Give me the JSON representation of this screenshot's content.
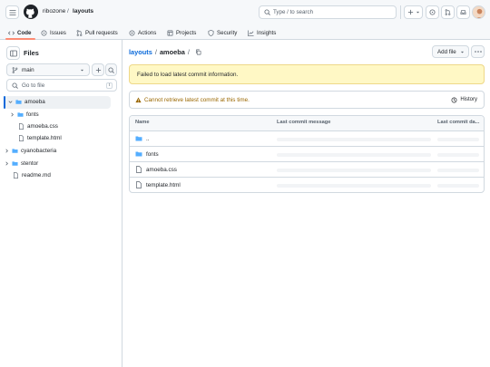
{
  "header": {
    "owner": "ribozone",
    "repo": "layouts",
    "search_placeholder": "Type / to search",
    "separator": "/"
  },
  "tabs": [
    {
      "label": "Code"
    },
    {
      "label": "Issues"
    },
    {
      "label": "Pull requests"
    },
    {
      "label": "Actions"
    },
    {
      "label": "Projects"
    },
    {
      "label": "Security"
    },
    {
      "label": "Insights"
    }
  ],
  "sidebar": {
    "title": "Files",
    "branch": "main",
    "filter_placeholder": "Go to file",
    "filter_shortcut": "t",
    "items": [
      {
        "label": "amoeba",
        "type": "folder",
        "expanded": true,
        "selected": true
      },
      {
        "label": "fonts",
        "type": "folder",
        "expanded": false
      },
      {
        "label": "amoeba.css",
        "type": "file"
      },
      {
        "label": "template.html",
        "type": "file"
      },
      {
        "label": "cyanobacteria",
        "type": "folder",
        "expanded": false
      },
      {
        "label": "stentor",
        "type": "folder",
        "expanded": false
      },
      {
        "label": "readme.md",
        "type": "file"
      }
    ]
  },
  "main": {
    "breadcrumb_repo": "layouts",
    "breadcrumb_dir": "amoeba",
    "breadcrumb_sep": "/",
    "add_file_label": "Add file",
    "error_text": "Failed to load latest commit information.",
    "warning_text": "Cannot retrieve latest commit at this time.",
    "history_label": "History",
    "columns": [
      "Name",
      "Last commit message",
      "Last commit da..."
    ],
    "rows": [
      {
        "name": "..",
        "type": "folder"
      },
      {
        "name": "fonts",
        "type": "folder"
      },
      {
        "name": "amoeba.css",
        "type": "file"
      },
      {
        "name": "template.html",
        "type": "file"
      }
    ]
  },
  "colors": {
    "accent": "#0969da",
    "folder": "#54aeff",
    "error_bg": "#fff8c5",
    "warning_text": "#9a6700",
    "selected_bar": "#0969da"
  }
}
